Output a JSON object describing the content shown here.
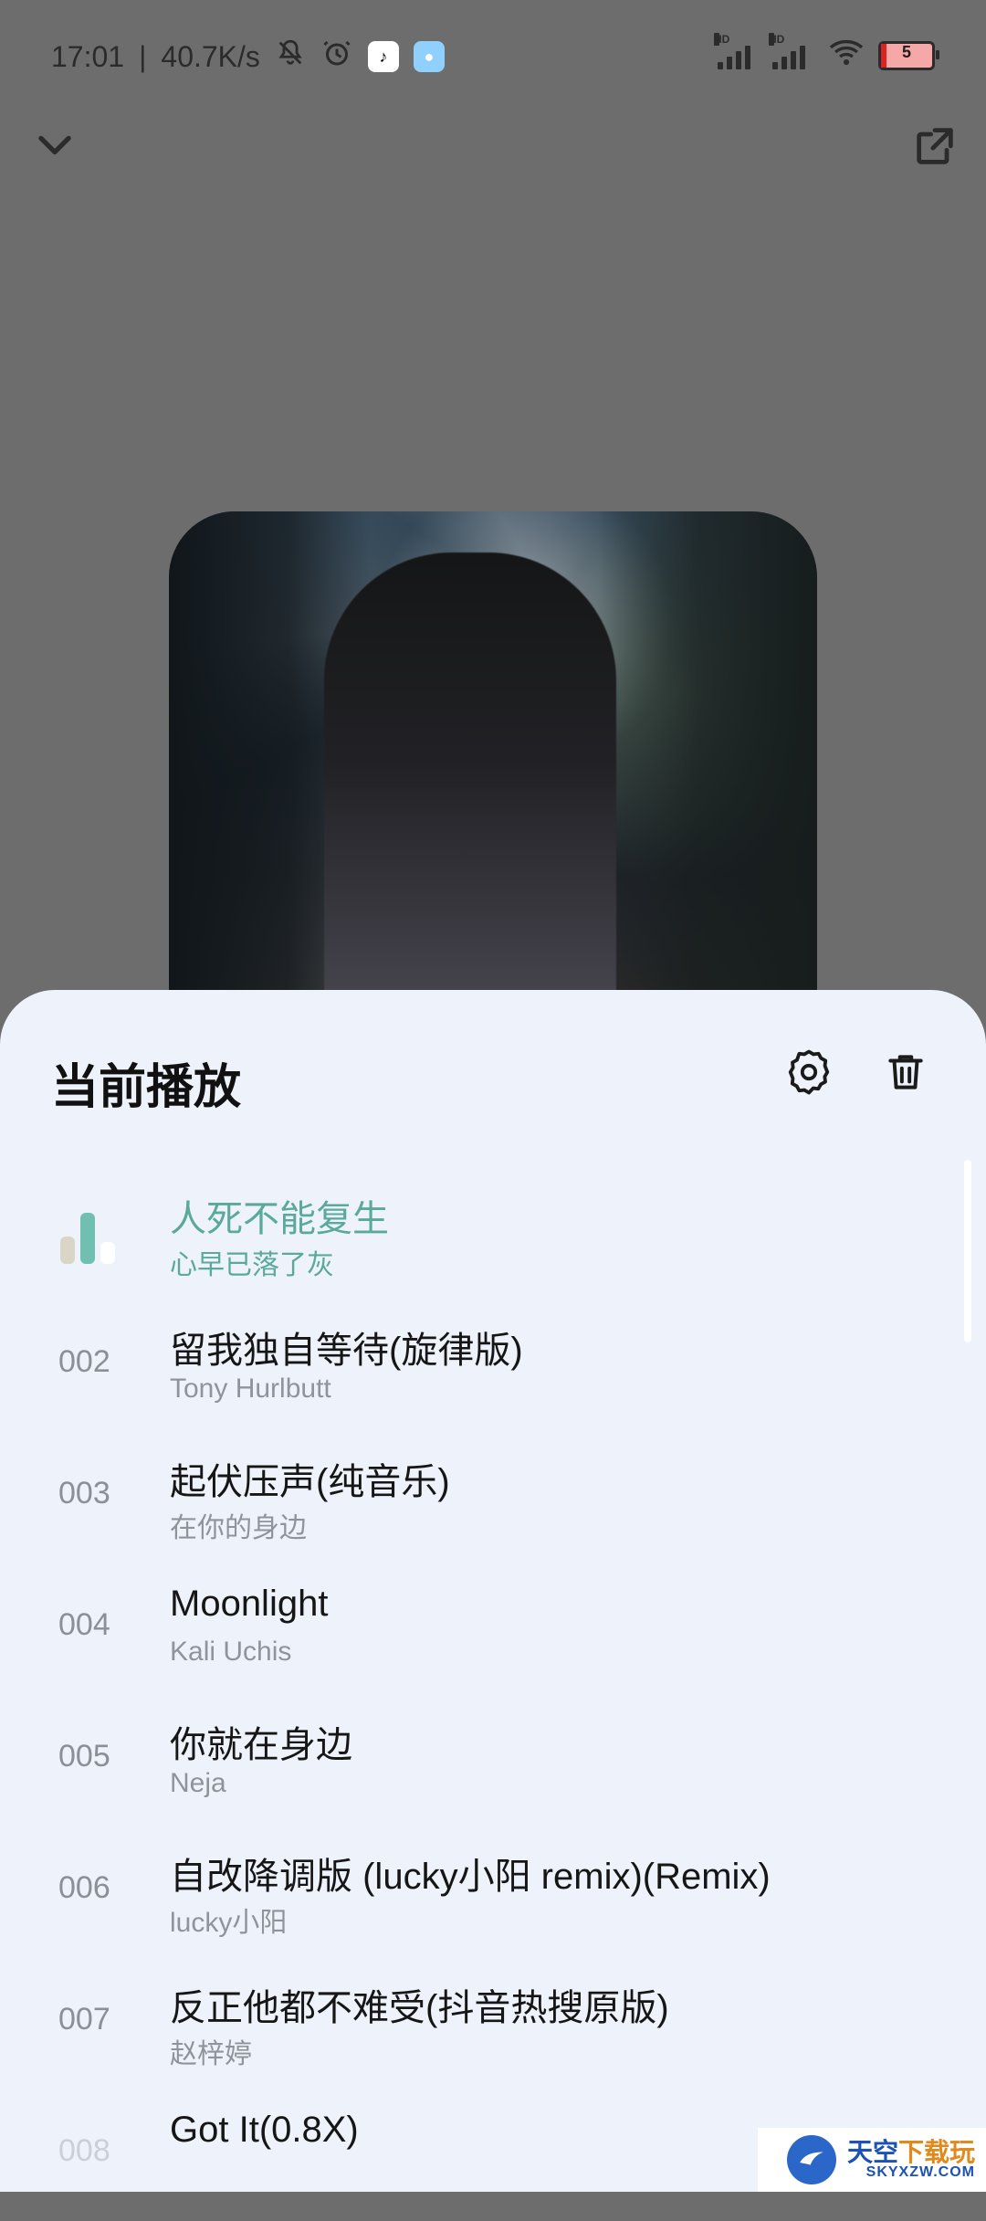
{
  "status_bar": {
    "time": "17:01",
    "net_speed": "40.7K/s",
    "battery_percent": "5",
    "icons": [
      "mute-bell-icon",
      "alarm-icon",
      "tiktok-app-icon",
      "qq-app-icon",
      "signal-hd-icon",
      "signal-hd-icon",
      "wifi-icon",
      "battery-icon"
    ]
  },
  "top_nav": {
    "collapse_icon": "chevron-down-icon",
    "share_icon": "share-icon"
  },
  "sheet": {
    "title": "当前播放",
    "actions": [
      "settings-icon",
      "trash-icon"
    ]
  },
  "tracks": [
    {
      "number": "",
      "title": "人死不能复生",
      "artist": "心早已落了灰",
      "active": true
    },
    {
      "number": "002",
      "title": "留我独自等待(旋律版)",
      "artist": "Tony Hurlbutt",
      "active": false
    },
    {
      "number": "003",
      "title": "起伏压声(纯音乐)",
      "artist": "在你的身边",
      "active": false
    },
    {
      "number": "004",
      "title": "Moonlight",
      "artist": "Kali Uchis",
      "active": false
    },
    {
      "number": "005",
      "title": "你就在身边",
      "artist": "Neja",
      "active": false
    },
    {
      "number": "006",
      "title": "自改降调版 (lucky小阳 remix)(Remix)",
      "artist": "lucky小阳",
      "active": false
    },
    {
      "number": "007",
      "title": "反正他都不难受(抖音热搜原版)",
      "artist": "赵梓婷",
      "active": false
    },
    {
      "number": "008",
      "title": "Got It(0.8X)",
      "artist": "",
      "active": false
    }
  ],
  "watermark": {
    "main_left": "天空",
    "main_right": "下载玩",
    "sub": "SKYXZW.COM"
  },
  "colors": {
    "accent": "#5aa99a",
    "sheet_bg": "#eef3fb",
    "overlay": "#6d6d6d"
  }
}
